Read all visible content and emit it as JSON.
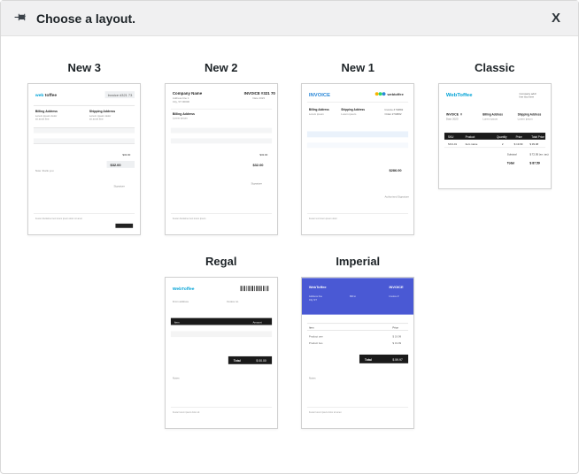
{
  "header": {
    "title": "Choose a layout.",
    "close_label": "X"
  },
  "layouts": [
    {
      "id": "new3",
      "label": "New 3"
    },
    {
      "id": "new2",
      "label": "New 2"
    },
    {
      "id": "new1",
      "label": "New 1"
    },
    {
      "id": "classic",
      "label": "Classic"
    },
    {
      "id": "regal",
      "label": "Regal"
    },
    {
      "id": "imperial",
      "label": "Imperial"
    }
  ],
  "brand": {
    "name": "WebToffee",
    "color": "#00a2d6",
    "accent": "#4a59d4"
  }
}
